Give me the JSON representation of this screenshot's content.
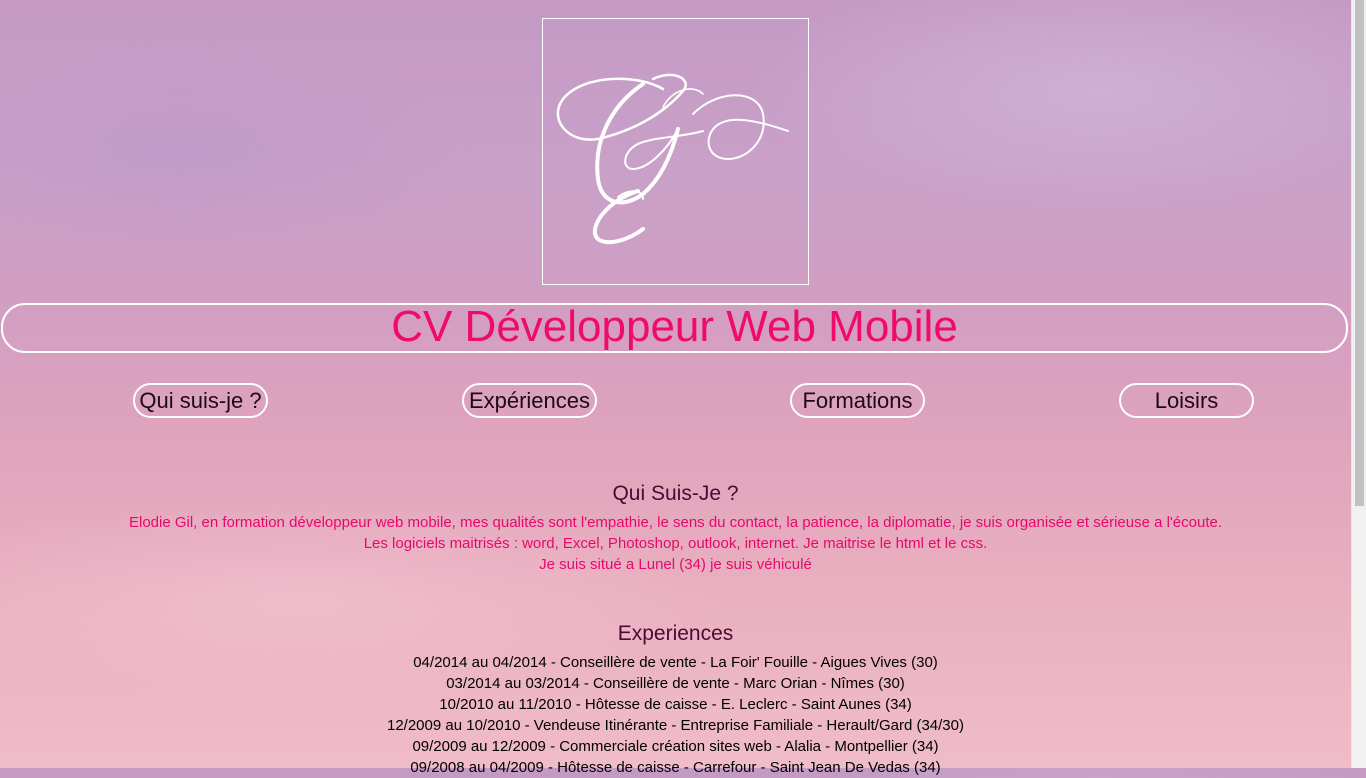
{
  "logo": {
    "alt": "GC monogram logo"
  },
  "header": {
    "title": "CV Développeur Web Mobile"
  },
  "nav": [
    {
      "label": "Qui suis-je ?"
    },
    {
      "label": "Expériences"
    },
    {
      "label": "Formations"
    },
    {
      "label": "Loisirs"
    }
  ],
  "about": {
    "heading": "Qui Suis-Je ?",
    "lines": [
      "Elodie Gil, en formation développeur web mobile, mes qualités sont l'empathie, le sens du contact, la patience, la diplomatie, je suis organisée et sérieuse a l'écoute.",
      "Les logiciels maitrisés : word, Excel, Photoshop, outlook, internet. Je maitrise le html et le css.",
      "Je suis situé a Lunel (34) je suis véhiculé"
    ]
  },
  "experiences": {
    "heading": "Experiences",
    "lines": [
      "04/2014 au 04/2014 - Conseillère de vente - La Foir' Fouille - Aigues Vives (30)",
      "03/2014 au 03/2014 - Conseillère de vente - Marc Orian - Nîmes (30)",
      "10/2010 au 11/2010 - Hôtesse de caisse - E. Leclerc - Saint Aunes (34)",
      "12/2009 au 10/2010 - Vendeuse Itinérante - Entreprise Familiale - Herault/Gard (34/30)",
      "09/2009 au 12/2009 - Commerciale création sites web - Alalia - Montpellier (34)",
      "09/2008 au 04/2009 - Hôtesse de caisse - Carrefour - Saint Jean De Vedas (34)"
    ]
  },
  "colors": {
    "accent": "#ef0a6b",
    "heading": "#4a0a34",
    "border": "#ffffff"
  }
}
